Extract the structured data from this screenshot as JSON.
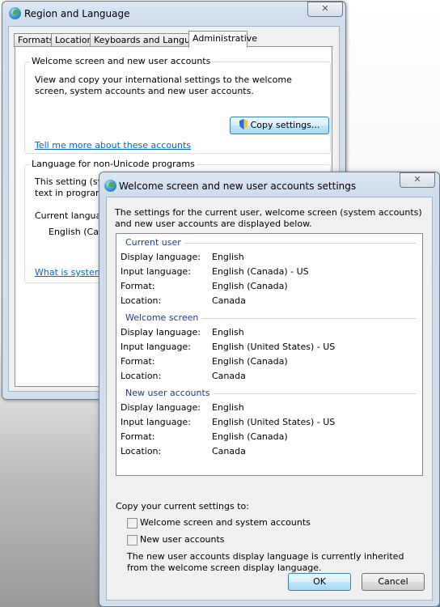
{
  "region_window": {
    "title": "Region and Language",
    "close_glyph": "✕",
    "tabs": [
      "Formats",
      "Location",
      "Keyboards and Languages",
      "Administrative"
    ],
    "welcome_group": {
      "label": "Welcome screen and new user accounts",
      "description": "View and copy your international settings to the welcome screen, system accounts and new user accounts.",
      "copy_button": "Copy settings...",
      "link": "Tell me more about these accounts"
    },
    "unicode_group": {
      "label": "Language for non-Unicode programs",
      "description_line1": "This setting (syste",
      "description_line2": "text in programs t",
      "current_label": "Current language",
      "current_value": "English (Cana",
      "link": "What is system lo"
    }
  },
  "settings_window": {
    "title": "Welcome screen and new user accounts settings",
    "close_glyph": "✕",
    "intro": "The settings for the current user, welcome screen (system accounts) and new user accounts are displayed below.",
    "sections": [
      {
        "header": "Current user",
        "rows": [
          {
            "label": "Display language:",
            "value": "English"
          },
          {
            "label": "Input language:",
            "value": "English (Canada) - US"
          },
          {
            "label": "Format:",
            "value": "English (Canada)"
          },
          {
            "label": "Location:",
            "value": "Canada"
          }
        ]
      },
      {
        "header": "Welcome screen",
        "rows": [
          {
            "label": "Display language:",
            "value": "English"
          },
          {
            "label": "Input language:",
            "value": "English (United States) - US"
          },
          {
            "label": "Format:",
            "value": "English (Canada)"
          },
          {
            "label": "Location:",
            "value": "Canada"
          }
        ]
      },
      {
        "header": "New user accounts",
        "rows": [
          {
            "label": "Display language:",
            "value": "English"
          },
          {
            "label": "Input language:",
            "value": "English (United States) - US"
          },
          {
            "label": "Format:",
            "value": "English (Canada)"
          },
          {
            "label": "Location:",
            "value": "Canada"
          }
        ]
      }
    ],
    "copy_label": "Copy your current settings to:",
    "checkboxes": [
      {
        "label": "Welcome screen and system accounts",
        "checked": false
      },
      {
        "label": "New user accounts",
        "checked": false
      }
    ],
    "note": "The new user accounts display language is currently inherited from the welcome screen display language.",
    "ok_button": "OK",
    "cancel_button": "Cancel"
  }
}
